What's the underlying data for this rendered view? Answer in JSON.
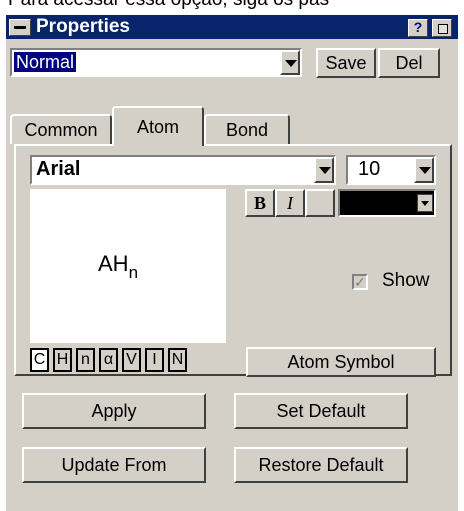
{
  "caption": "Para acessar essa opção, siga os pas",
  "window": {
    "title": "Properties",
    "help_glyph": "?"
  },
  "style_row": {
    "selected": "Normal",
    "save_label": "Save",
    "del_label": "Del"
  },
  "tabs": [
    {
      "label": "Common",
      "active": false
    },
    {
      "label": "Atom",
      "active": true
    },
    {
      "label": "Bond",
      "active": false
    }
  ],
  "atom_panel": {
    "font": "Arial",
    "size": "10",
    "bold_label": "B",
    "italic_label": "I",
    "underline_label": "",
    "color": "#000000",
    "preview_main": "AH",
    "preview_sub": "n",
    "show_checked": true,
    "show_label": "Show",
    "symbol_buttons": [
      "C",
      "H",
      "n",
      "α",
      "V",
      "I",
      "N"
    ],
    "atom_symbol_label": "Atom Symbol"
  },
  "footer": {
    "apply_label": "Apply",
    "set_default_label": "Set Default",
    "update_from_label": "Update From",
    "restore_default_label": "Restore Default"
  },
  "colors": {
    "title_bar": "#08246b",
    "face": "#d4d0c8",
    "selection": "#000080"
  },
  "icons": {
    "system_menu": "minus-box-icon",
    "dropdown": "triangle-down-icon",
    "checkbox": "check-mark-icon"
  }
}
